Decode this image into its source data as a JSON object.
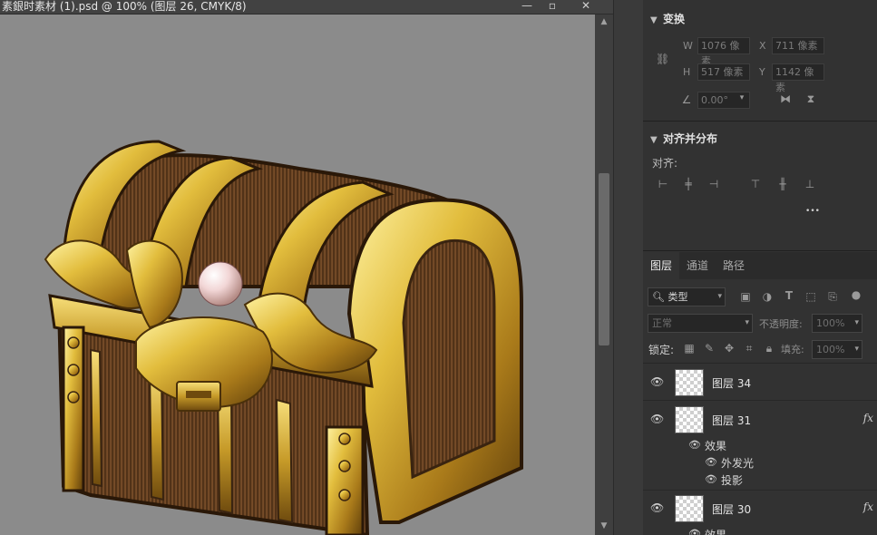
{
  "document": {
    "title": "素銀时素材 (1).psd @ 100% (图层 26, CMYK/8)",
    "window_buttons": {
      "minimize": "—",
      "maximize": "▫",
      "close": "✕"
    }
  },
  "transform": {
    "title": "变换",
    "w_label": "W",
    "w_value": "1076 像素",
    "x_label": "X",
    "x_value": "711 像素",
    "h_label": "H",
    "h_value": "517 像素",
    "y_label": "Y",
    "y_value": "1142 像素",
    "angle_value": "0.00°"
  },
  "align": {
    "title": "对齐并分布",
    "align_label": "对齐:",
    "more": "•••"
  },
  "layers_panel": {
    "tabs": [
      "图层",
      "通道",
      "路径"
    ],
    "filter_kind": "类型",
    "blend_mode": "正常",
    "opacity_label": "不透明度:",
    "opacity_value": "100%",
    "lock_label": "锁定:",
    "fill_label": "填充:",
    "fill_value": "100%",
    "layers": [
      {
        "name": "图层 34",
        "fx": ""
      },
      {
        "name": "图层 31",
        "fx": "fx",
        "effects_label": "效果",
        "effects": [
          "外发光",
          "投影"
        ]
      },
      {
        "name": "图层 30",
        "fx": "fx",
        "effects_label": "效果"
      }
    ]
  },
  "colors": {
    "canvas_bg": "#8b8b8b",
    "panel_bg": "#323232",
    "gold": "#d8b431",
    "wood": "#6b4524"
  }
}
